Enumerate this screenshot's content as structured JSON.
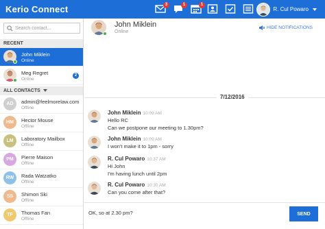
{
  "app": {
    "title": "Kerio Connect"
  },
  "colors": {
    "primary": "#1e6ed8",
    "online": "#4caf50",
    "badge_red": "#e53935"
  },
  "topbar": {
    "icons": [
      {
        "name": "mail-icon",
        "badge": "3"
      },
      {
        "name": "chat-icon",
        "badge": "1"
      },
      {
        "name": "calendar-icon",
        "badge": "1"
      },
      {
        "name": "contacts-icon",
        "badge": ""
      },
      {
        "name": "tasks-icon",
        "badge": ""
      },
      {
        "name": "notes-icon",
        "badge": ""
      }
    ],
    "user_name": "R. Cul Powaro"
  },
  "sidebar": {
    "search_placeholder": "Search contact...",
    "recent_header": "RECENT",
    "all_contacts_header": "ALL CONTACTS",
    "recent": [
      {
        "name": "John Miklein",
        "status": "Online",
        "initials": "",
        "active": true,
        "unread": "",
        "color": "#d9a77a",
        "status_color": "#4caf50"
      },
      {
        "name": "Meg Regret",
        "status": "Online",
        "initials": "",
        "active": false,
        "unread": "2",
        "color": "#c88b6e",
        "status_color": "#4caf50"
      }
    ],
    "contacts": [
      {
        "name": "admin@feelmorelaw.com",
        "status": "Offline",
        "initials": "AD",
        "color": "#cfcfcf"
      },
      {
        "name": "Hector Mouse",
        "status": "Offline",
        "initials": "HM",
        "color": "#f0b98c"
      },
      {
        "name": "Laboratory Mailbox",
        "status": "Offline",
        "initials": "LM",
        "color": "#c9c07d"
      },
      {
        "name": "Pierre Maison",
        "status": "Offline",
        "initials": "PM",
        "color": "#d8a6e0"
      },
      {
        "name": "Rada Watzatko",
        "status": "Offline",
        "initials": "RW",
        "color": "#8fc1e8"
      },
      {
        "name": "Shimon Ski",
        "status": "Offline",
        "initials": "SS",
        "color": "#f0b98c"
      },
      {
        "name": "Thomas Fan",
        "status": "Offline",
        "initials": "TF",
        "color": "#f0c96e"
      }
    ]
  },
  "conversation": {
    "name": "John Miklein",
    "status": "Online",
    "hide_notifications": "HIDE NOTIFICATIONS",
    "date": "7/12/2016",
    "messages": [
      {
        "author": "John Miklein",
        "time": "10:09 AM",
        "lines": [
          "Hello RC",
          "Can we postpone our meeting to 1.30pm?"
        ],
        "avatar": "john"
      },
      {
        "author": "John Miklein",
        "time": "10:09 AM",
        "lines": [
          "I won't make it to 1pm - sorry"
        ],
        "avatar": "john"
      },
      {
        "author": "R. Cul Powaro",
        "time": "10:37 AM",
        "lines": [
          "Hi John",
          "I'm having lunch until 2pm"
        ],
        "avatar": "rc"
      },
      {
        "author": "R. Cul Powaro",
        "time": "10:30 AM",
        "lines": [
          "Can you come after that?"
        ],
        "avatar": "rc"
      }
    ],
    "composer_text": "OK, so at 2.30 pm?",
    "send_label": "SEND"
  }
}
